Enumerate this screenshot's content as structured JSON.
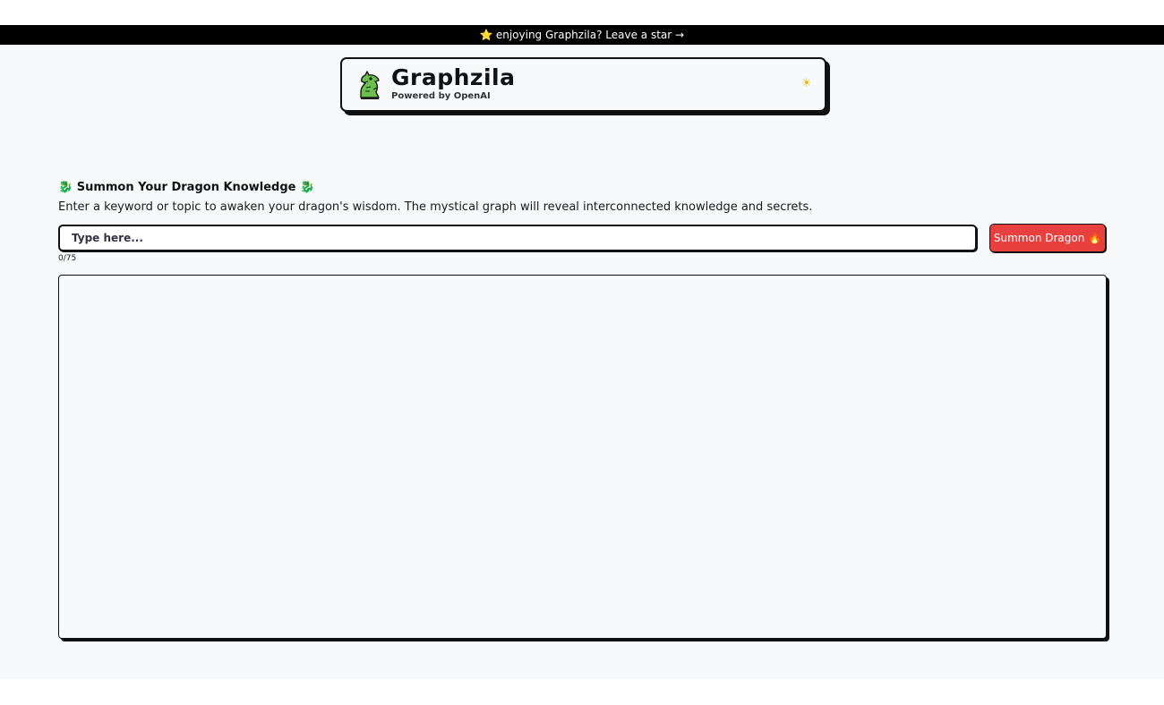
{
  "banner": {
    "star_icon": "⭐",
    "text": "enjoying Graphzila? Leave a star →"
  },
  "header": {
    "logo_icon": "dragon-head-icon",
    "title": "Graphzila",
    "subtitle": "Powered by OpenAI",
    "theme_icon": "☀"
  },
  "main": {
    "heading_left_icon": "🐉",
    "heading": "Summon Your Dragon Knowledge",
    "heading_right_icon": "🐉",
    "description": "Enter a keyword or topic to awaken your dragon's wisdom. The mystical graph will reveal interconnected knowledge and secrets.",
    "search": {
      "value": "",
      "placeholder": "Type here..."
    },
    "char_count": "0/75",
    "button_label": "Summon Dragon 🔥"
  },
  "colors": {
    "banner_bg": "#000000",
    "page_bg": "#f7f9fb",
    "button_bg": "#e8403f",
    "border": "#111111"
  }
}
